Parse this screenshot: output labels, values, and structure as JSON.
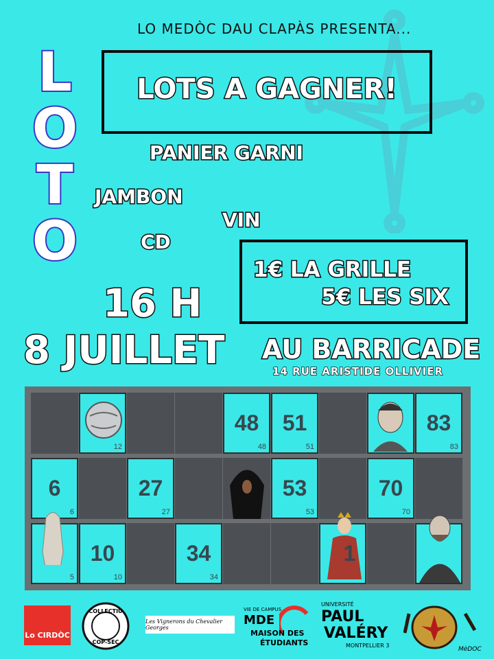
{
  "presenter": "LO MEDÒC DAU CLAPÀS PRESENTA...",
  "title_letters": [
    "L",
    "O",
    "T",
    "O"
  ],
  "prizes": {
    "header": "LOTS A GAGNER!",
    "items": [
      "PANIER GARNI",
      "JAMBON",
      "VIN",
      "CD"
    ]
  },
  "prices": {
    "line1": "1€ LA GRILLE",
    "line2": "5€ LES SIX"
  },
  "time": "16 H",
  "date": "8 JUILLET",
  "venue": {
    "name": "AU BARRICADE",
    "address": "14 RUE ARISTIDE OLLIVIER"
  },
  "grid": {
    "rows": [
      [
        null,
        {
          "num": "12",
          "img": "petanque ball"
        },
        null,
        null,
        {
          "num": "48"
        },
        {
          "num": "51"
        },
        null,
        {
          "num": "83",
          "img": "portrait man"
        }
      ],
      [
        {
          "num": "6",
          "img": "statue"
        },
        null,
        {
          "num": "27"
        },
        {
          "img": "hooded figure"
        },
        {
          "num": "53"
        },
        null,
        {
          "num": "70"
        },
        null
      ],
      [
        {
          "num": "5",
          "img": "statue"
        },
        {
          "num": "10"
        },
        null,
        {
          "num": "34"
        },
        null,
        {
          "num": "1",
          "img": "queen"
        },
        null,
        {
          "img": "portrait bearded man"
        }
      ]
    ]
  },
  "sponsors": {
    "cirdoc": "Lo CIRDÒC",
    "copsec_top": "COLLECTIU",
    "copsec_bottom": "COP-SEC",
    "vignerons": "Les Vignerons du Chevalier Georges",
    "mde_small": "VIE DE CAMPUS",
    "mde_big": "MDE",
    "mde_line1": "MAISON DES",
    "mde_line2": "ÉTUDIANTS",
    "paulvalery_small": "UNIVERSITÉ",
    "paulvalery_line1": "PAUL",
    "paulvalery_line2": "VALÉRY",
    "paulvalery_line3": "MONTPELLIER 3",
    "medoc_logo": "MèDOC"
  },
  "colors": {
    "background": "#3be8e8",
    "loto_outline": "#3a36c8",
    "grid": "#6b6f72",
    "cirdoc_red": "#e8302a"
  }
}
